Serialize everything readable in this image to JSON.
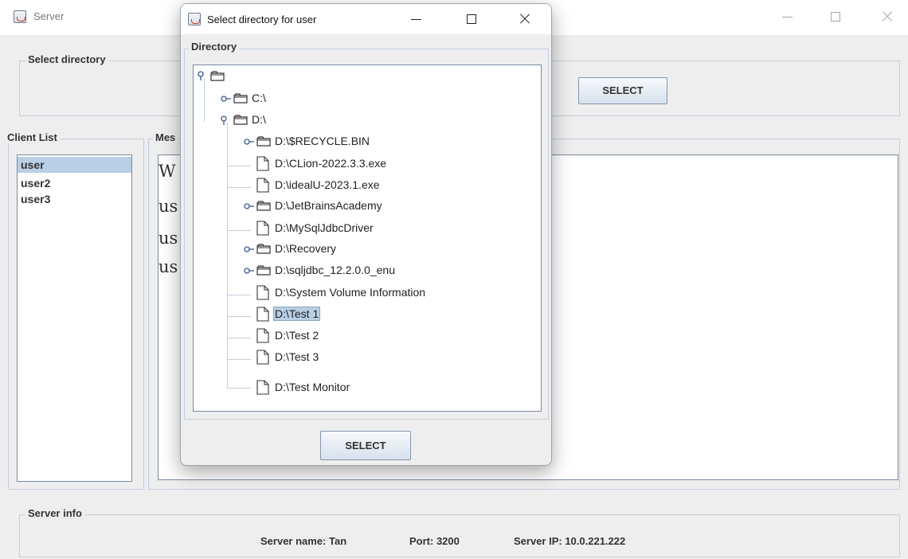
{
  "main_window": {
    "title": "Server",
    "select_directory": {
      "legend": "Select directory",
      "button": "SELECT"
    },
    "client_list": {
      "legend": "Client List",
      "items": [
        "user",
        "user2",
        "user3"
      ],
      "selected": "user"
    },
    "messages": {
      "legend": "Mes",
      "lines": [
        "W",
        "us",
        "us",
        "us"
      ]
    },
    "server_info": {
      "legend": "Server info",
      "server_name": "Server name: Tan",
      "port": "Port: 3200",
      "server_ip": "Server IP: 10.0.221.222"
    }
  },
  "dialog": {
    "title": "Select directory for user",
    "group_legend": "Directory",
    "tree": {
      "drive_c": "C:\\",
      "drive_d": "D:\\",
      "children": [
        "D:\\$RECYCLE.BIN",
        "D:\\CLion-2022.3.3.exe",
        "D:\\idealU-2023.1.exe",
        "D:\\JetBrainsAcademy",
        "D:\\MySqlJdbcDriver",
        "D:\\Recovery",
        "D:\\sqljdbc_12.2.0.0_enu",
        "D:\\System Volume Information",
        "D:\\Test 1",
        "D:\\Test 2",
        "D:\\Test 3",
        "D:\\Test Monitor"
      ],
      "selected": "D:\\Test 1"
    },
    "select_button": "SELECT"
  },
  "colors": {
    "selection": "#b8cfe5",
    "border": "#c2cede",
    "button_border": "#8597ad"
  }
}
